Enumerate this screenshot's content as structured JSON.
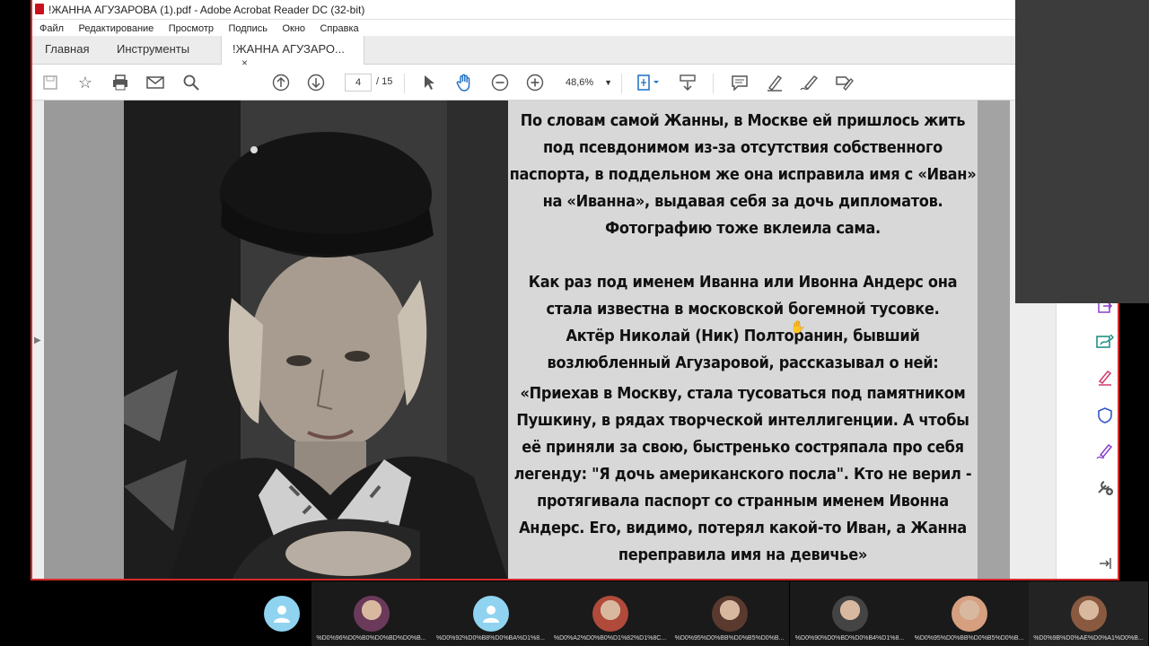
{
  "window": {
    "title": "!ЖАННА АГУЗАРОВА (1).pdf - Adobe Acrobat Reader DC (32-bit)"
  },
  "menu": [
    "Файл",
    "Редактирование",
    "Просмотр",
    "Подпись",
    "Окно",
    "Справка"
  ],
  "tabs": {
    "home": "Главная",
    "tools": "Инструменты",
    "doc": "!ЖАННА АГУЗАРО...",
    "close": "×"
  },
  "toolbar": {
    "page_current": "4",
    "page_total": "/ 15",
    "zoom": "48,6%"
  },
  "document": {
    "p1": "По словам самой Жанны, в Москве ей пришлось жить под псевдонимом из-за отсутствия собственного паспорта, в поддельном же она исправила имя с «Иван» на «Иванна», выдавая себя за дочь дипломатов. Фотографию тоже вклеила сама.",
    "p2a": "Как раз под именем Иванна или Ивонна Андерс она стала известна в московской богемной тусовке.",
    "p2b": "Актёр Николай (Ник) Полторанин, бывший возлюбленный Агузаровой, рассказывал о ней:",
    "p3": "«Приехав в Москву, стала тусоваться под памятником Пушкину, в рядах творческой интеллигенции. А чтобы её приняли за свою, быстренько состряпала про себя легенду: \"Я дочь американского посла\". Кто не верил - протягивала паспорт со странным именем Ивонна Андерс. Его, видимо, потерял какой-то Иван, а Жанна переправила имя на девичье»"
  },
  "participants": [
    {
      "name": "",
      "avatar": "blank"
    },
    {
      "name": "%D0%96%D0%B0%D0%BD%D0%B...",
      "avatar": "photo",
      "color": "#6b3a5a"
    },
    {
      "name": "%D0%92%D0%B8%D0%BA%D1%8...",
      "avatar": "blank"
    },
    {
      "name": "%D0%A2%D0%B0%D1%82%D1%8C...",
      "avatar": "photo",
      "color": "#b04a3a"
    },
    {
      "name": "%D0%95%D0%BB%D0%B5%D0%B...",
      "avatar": "photo",
      "color": "#5a3a2e"
    },
    {
      "name": "%D0%90%D0%BD%D0%B4%D1%8...",
      "avatar": "photo",
      "color": "#444444"
    },
    {
      "name": "%D0%95%D0%BB%D0%B5%D0%B...",
      "avatar": "photo",
      "color": "#d6a080"
    },
    {
      "name": "%D0%9B%D0%AE%D0%A1%D0%B...",
      "avatar": "photo",
      "color": "#8a5a40"
    }
  ],
  "colors": {
    "accent": "#d62b2b",
    "toolbar_blue": "#1b6ec2",
    "tool_purple": "#8a3fc9",
    "tool_teal": "#138a7e"
  }
}
